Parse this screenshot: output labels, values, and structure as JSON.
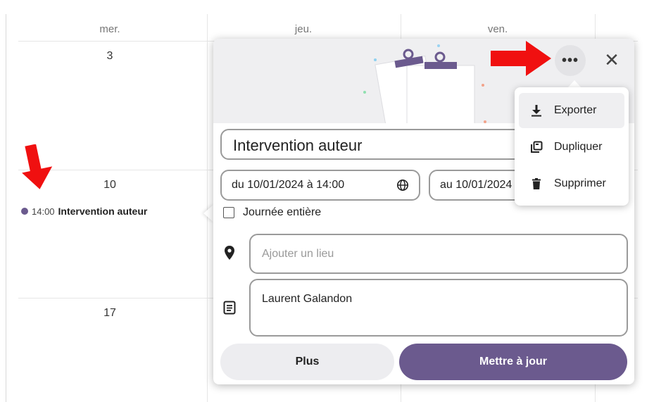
{
  "calendar": {
    "day_headers": [
      "mer.",
      "jeu.",
      "ven."
    ],
    "day_numbers": [
      "3",
      "10",
      "17"
    ],
    "event": {
      "time": "14:00",
      "title": "Intervention auteur",
      "color": "#6b5a8e"
    }
  },
  "popup": {
    "more_icon": "more-horizontal-icon",
    "more_label": "•••",
    "close_label": "✕",
    "title_value": "Intervention auteur",
    "start_value": "du 10/01/2024 à 14:00",
    "end_value": "au 10/01/2024",
    "allday_label": "Journée entière",
    "location_placeholder": "Ajouter un lieu",
    "description_value": "Laurent Galandon",
    "plus_label": "Plus",
    "update_label": "Mettre à jour",
    "accent": "#6b5a8e"
  },
  "menu": {
    "items": [
      {
        "label": "Exporter",
        "icon": "download-icon"
      },
      {
        "label": "Dupliquer",
        "icon": "duplicate-icon"
      },
      {
        "label": "Supprimer",
        "icon": "trash-icon"
      }
    ]
  },
  "annotations": {
    "arrow_color": "#ff0000"
  }
}
